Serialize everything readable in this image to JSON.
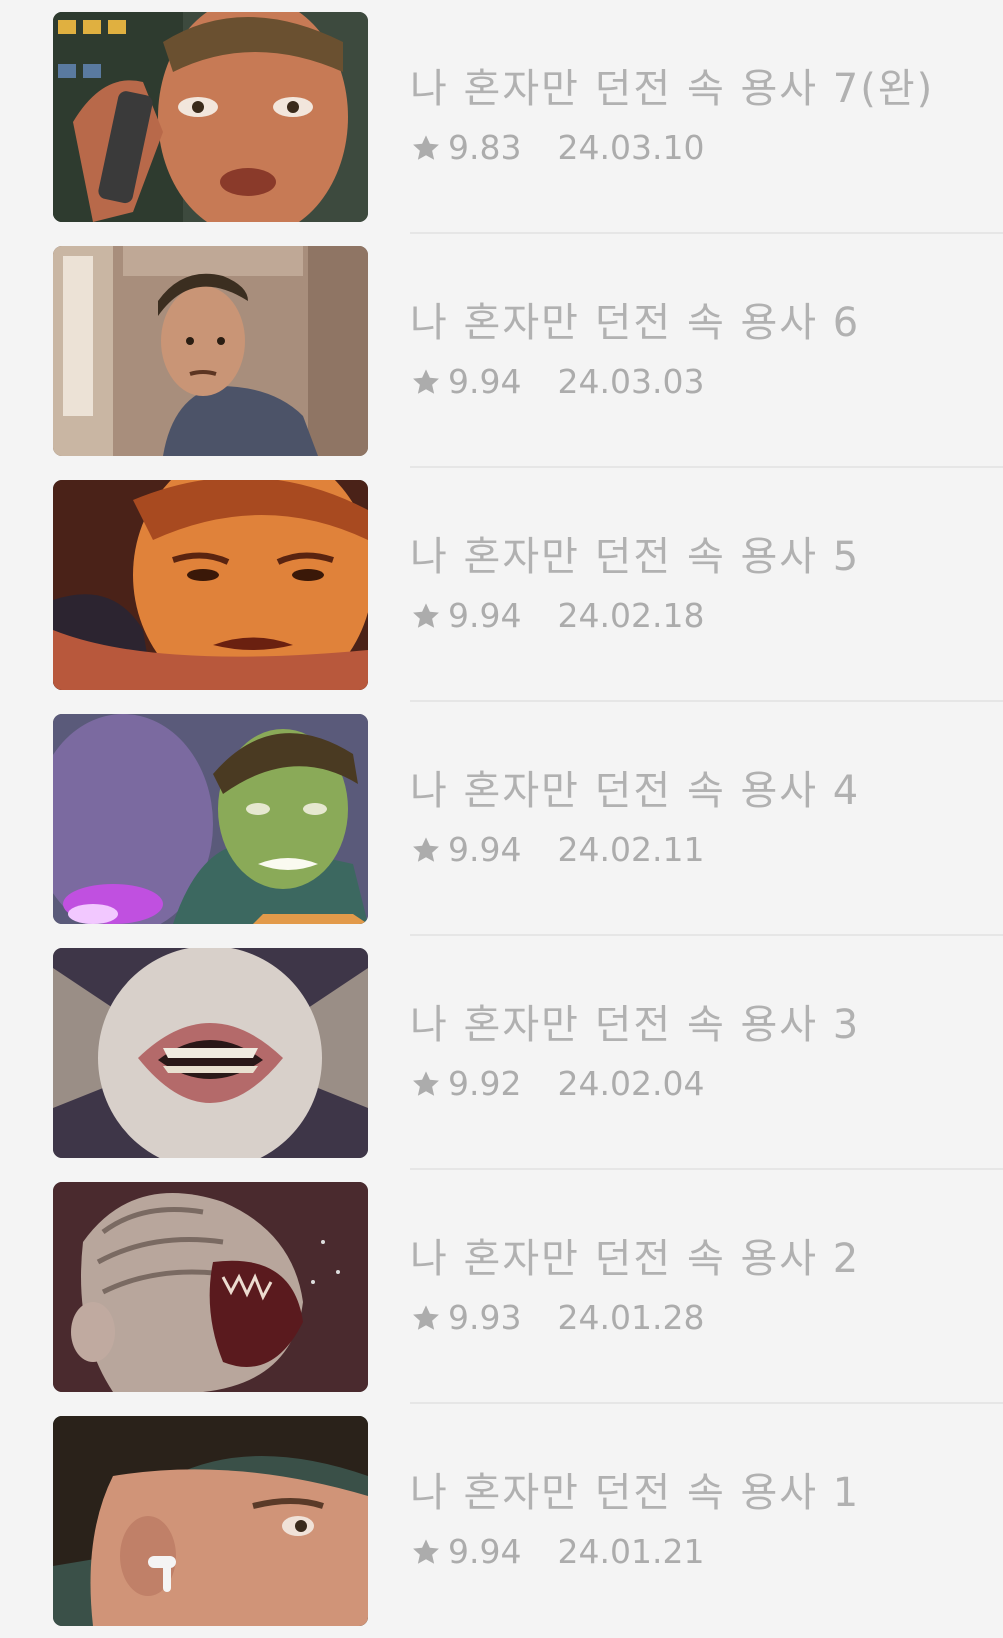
{
  "episodes": [
    {
      "title": "나 혼자만 던전 속 용사 7(완)",
      "rating": "9.83",
      "date": "24.03.10",
      "thumbnail": "boy-with-phone-thumbnail"
    },
    {
      "title": "나 혼자만 던전 속 용사 6",
      "rating": "9.94",
      "date": "24.03.03",
      "thumbnail": "boy-in-hallway-thumbnail"
    },
    {
      "title": "나 혼자만 던전 속 용사 5",
      "rating": "9.94",
      "date": "24.02.18",
      "thumbnail": "boy-orange-light-thumbnail"
    },
    {
      "title": "나 혼자만 던전 속 용사 4",
      "rating": "9.94",
      "date": "24.02.11",
      "thumbnail": "boy-green-glow-thumbnail"
    },
    {
      "title": "나 혼자만 던전 속 용사 3",
      "rating": "9.92",
      "date": "24.02.04",
      "thumbnail": "mouth-creature-thumbnail"
    },
    {
      "title": "나 혼자만 던전 속 용사 2",
      "rating": "9.93",
      "date": "24.01.28",
      "thumbnail": "screaming-monster-thumbnail"
    },
    {
      "title": "나 혼자만 던전 속 용사 1",
      "rating": "9.94",
      "date": "24.01.21",
      "thumbnail": "boy-with-earbud-thumbnail"
    }
  ],
  "icons": {
    "rating": "star-icon"
  },
  "colors": {
    "text": "#b1b1b1",
    "background": "#f4f4f4",
    "divider": "#e6e6e6"
  }
}
